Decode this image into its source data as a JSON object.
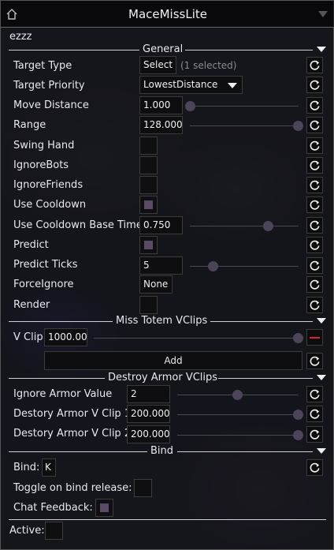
{
  "window": {
    "title": "MaceMissLite",
    "module_name": "ezzz"
  },
  "sections": {
    "general": "General",
    "totem": "Miss Totem VClips",
    "armor": "Destroy Armor VClips",
    "bind": "Bind"
  },
  "settings": {
    "target_type": {
      "label": "Target Type",
      "button": "Select",
      "info": "(1 selected)"
    },
    "target_priority": {
      "label": "Target Priority",
      "value": "LowestDistance"
    },
    "move_distance": {
      "label": "Move Distance",
      "value": "1.000",
      "level": 0.0
    },
    "range": {
      "label": "Range",
      "value": "128.000",
      "level": 1.0
    },
    "swing_hand": {
      "label": "Swing Hand",
      "checked": false
    },
    "ignore_bots": {
      "label": "IgnoreBots",
      "checked": false
    },
    "ignore_friends": {
      "label": "IgnoreFriends",
      "checked": false
    },
    "use_cooldown": {
      "label": "Use Cooldown",
      "checked": true
    },
    "cooldown_base_time": {
      "label": "Use Cooldown Base Time",
      "value": "0.750",
      "level": 0.75
    },
    "predict": {
      "label": "Predict",
      "checked": true
    },
    "predict_ticks": {
      "label": "Predict Ticks",
      "value": "5",
      "level": 0.05
    },
    "force_ignore": {
      "label": "ForceIgnore",
      "value": "None"
    },
    "render": {
      "label": "Render",
      "checked": false
    }
  },
  "totem": {
    "vclip": {
      "label": "V Clip",
      "value": "1000.00",
      "level": 1.0
    },
    "add_label": "Add"
  },
  "armor": {
    "ignore_armor_value": {
      "label": "Ignore Armor Value",
      "value": "2",
      "level": 0.5
    },
    "vclip1": {
      "label": "Destory Armor V Clip 1",
      "value": "200.000",
      "level": 1.0
    },
    "vclip2": {
      "label": "Destory Armor V Clip 2",
      "value": "200.000",
      "level": 1.0
    }
  },
  "bind": {
    "bind": {
      "label": "Bind:",
      "value": "K"
    },
    "toggle_on_release": {
      "label": "Toggle on bind release:",
      "checked": false
    },
    "chat_feedback": {
      "label": "Chat Feedback:",
      "checked": true
    }
  },
  "active": {
    "label": "Active:",
    "checked": false
  },
  "icons": [
    "home-icon",
    "collapse-icon",
    "reset-icon",
    "dropdown-arrow-icon",
    "remove-icon"
  ],
  "colors": {
    "remove": "#e0202a",
    "slider_knob": "#4c4458",
    "check_fill": "#5a4a66"
  }
}
